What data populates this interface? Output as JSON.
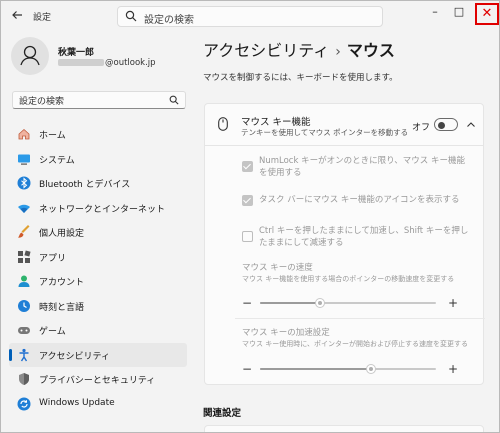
{
  "app": {
    "title": "設定"
  },
  "search": {
    "placeholder": "設定の検索"
  },
  "window_controls": {
    "minimize": "–",
    "maximize": "□",
    "close": "✕"
  },
  "profile": {
    "name": "秋葉一郎",
    "email_suffix": "@outlook.jp"
  },
  "sidebar": {
    "search_placeholder": "設定の検索",
    "items": [
      {
        "label": "ホーム",
        "icon": "home-icon"
      },
      {
        "label": "システム",
        "icon": "system-icon"
      },
      {
        "label": "Bluetooth とデバイス",
        "icon": "bluetooth-icon"
      },
      {
        "label": "ネットワークとインターネット",
        "icon": "network-icon"
      },
      {
        "label": "個人用設定",
        "icon": "brush-icon"
      },
      {
        "label": "アプリ",
        "icon": "apps-icon"
      },
      {
        "label": "アカウント",
        "icon": "account-icon"
      },
      {
        "label": "時刻と言語",
        "icon": "time-language-icon"
      },
      {
        "label": "ゲーム",
        "icon": "gaming-icon"
      },
      {
        "label": "アクセシビリティ",
        "icon": "accessibility-icon",
        "active": true
      },
      {
        "label": "プライバシーとセキュリティ",
        "icon": "shield-icon"
      },
      {
        "label": "Windows Update",
        "icon": "update-icon"
      }
    ]
  },
  "main": {
    "breadcrumb_parent": "アクセシビリティ",
    "breadcrumb_sep": "›",
    "breadcrumb_current": "マウス",
    "description": "マウスを制御するには、キーボードを使用します。",
    "mouse_keys": {
      "title": "マウス キー機能",
      "subtitle": "テンキーを使用してマウス ポインターを移動する",
      "toggle_label": "オフ",
      "toggle_on": false,
      "options": [
        {
          "label": "NumLock キーがオンのときに限り、マウス キー機能を使用する",
          "checked": true
        },
        {
          "label": "タスク バーにマウス キー機能のアイコンを表示する",
          "checked": true
        },
        {
          "label": "Ctrl キーを押したままにして加速し、Shift キーを押したままにして減速する",
          "checked": false
        }
      ],
      "speed": {
        "title": "マウス キーの速度",
        "subtitle": "マウス キー機能を使用する場合のポインターの移動速度を変更する",
        "value": 0.34
      },
      "acceleration": {
        "title": "マウス キーの加速設定",
        "subtitle": "マウス キー使用時に、ポインターが開始および停止する速度を変更する",
        "value": 0.63
      },
      "minus": "−",
      "plus": "+"
    },
    "related_title": "関連設定"
  }
}
